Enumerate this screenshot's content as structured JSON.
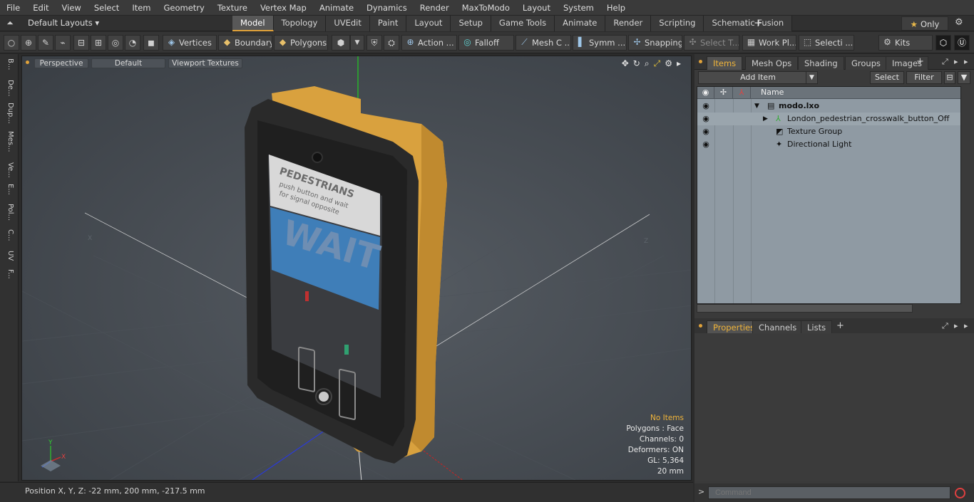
{
  "menu": [
    "File",
    "Edit",
    "View",
    "Select",
    "Item",
    "Geometry",
    "Texture",
    "Vertex Map",
    "Animate",
    "Dynamics",
    "Render",
    "MaxToModo",
    "Layout",
    "System",
    "Help"
  ],
  "layouts": {
    "label": "Default Layouts ▾"
  },
  "tabs": [
    "Model",
    "Topology",
    "UVEdit",
    "Paint",
    "Layout",
    "Setup",
    "Game Tools",
    "Animate",
    "Render",
    "Scripting",
    "Schematic Fusion"
  ],
  "only_label": "Only",
  "toolbar": {
    "vertices": "Vertices",
    "boundary": "Boundary",
    "polygons": "Polygons",
    "action": "Action",
    "falloff": "Falloff",
    "mesh": "Mesh C ...",
    "symm": "Symm ...",
    "snapping": "Snapping",
    "select_t": "Select T...",
    "workpl": "Work Pl...",
    "selecti": "Selecti ...",
    "kits": "Kits"
  },
  "left_strip": [
    "B...",
    "De...",
    "Dup...",
    "Mes...",
    "Ve...",
    "E...",
    "Pol...",
    "C...",
    "UV",
    "F..."
  ],
  "viewport": {
    "view": "Perspective",
    "shading": "Default",
    "textures": "Viewport Textures",
    "axis_x": "X",
    "axis_y": "Y",
    "axis_z": "Z"
  },
  "model_text": {
    "line1": "PEDESTRIANS",
    "line2": "push button and wait",
    "line3": "for signal opposite",
    "wait": "WAIT"
  },
  "stats": {
    "items": "No Items",
    "polygons": "Polygons : Face",
    "channels": "Channels: 0",
    "deformers": "Deformers: ON",
    "gl": "GL: 5,364",
    "size": "20 mm"
  },
  "status": {
    "position": "Position X, Y, Z:  -22 mm, 200 mm, -217.5 mm"
  },
  "items_panel": {
    "tabs": [
      "Items",
      "Mesh Ops",
      "Shading",
      "Groups",
      "Images"
    ],
    "add_item": "Add Item",
    "select": "Select",
    "filter": "Filter",
    "col_name": "Name",
    "rows": [
      {
        "label": "modo.lxo"
      },
      {
        "label": "London_pedestrian_crosswalk_button_Off"
      },
      {
        "label": "Texture Group"
      },
      {
        "label": "Directional Light"
      }
    ]
  },
  "props_panel": {
    "tabs": [
      "Properties",
      "Channels",
      "Lists"
    ]
  },
  "command": {
    "placeholder": "Command"
  },
  "colors": {
    "accent": "#e0a23a",
    "viewport_bg": "#454a50",
    "items_bg": "#8f9aa3"
  }
}
